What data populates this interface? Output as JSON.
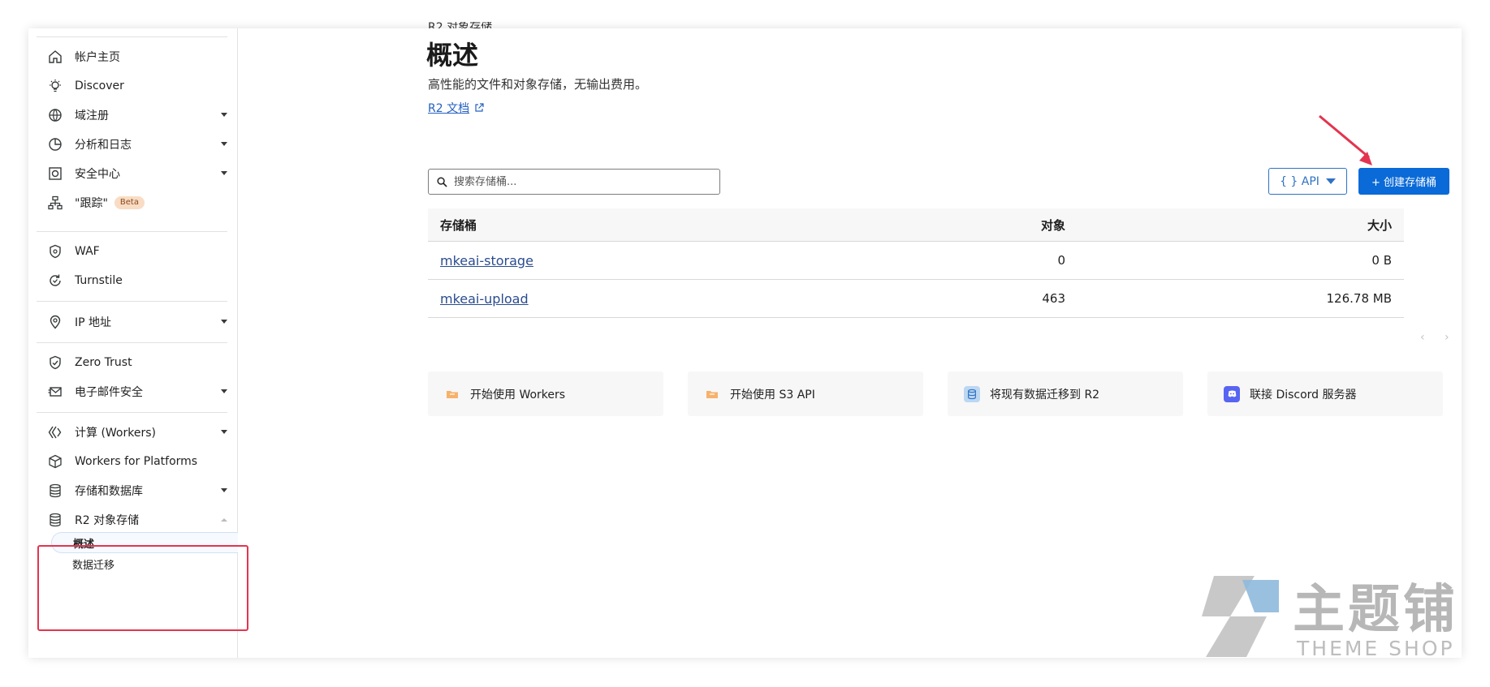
{
  "sidebar": {
    "items": [
      {
        "label": "帐户主页",
        "icon": "home-icon"
      },
      {
        "label": "Discover",
        "icon": "bulb-icon"
      },
      {
        "label": "域注册",
        "icon": "globe-icon"
      },
      {
        "label": "分析和日志",
        "icon": "chart-icon"
      },
      {
        "label": "安全中心",
        "icon": "security-icon"
      },
      {
        "label": "\"跟踪\"",
        "icon": "sitemap-icon",
        "badge": "Beta"
      },
      {
        "label": "WAF",
        "icon": "shield-icon"
      },
      {
        "label": "Turnstile",
        "icon": "turnstile-icon"
      },
      {
        "label": "IP 地址",
        "icon": "location-icon"
      },
      {
        "label": "Zero Trust",
        "icon": "zero-trust-icon"
      },
      {
        "label": "电子邮件安全",
        "icon": "email-icon"
      },
      {
        "label": "计算 (Workers)",
        "icon": "workers-icon"
      },
      {
        "label": "Workers for Platforms",
        "icon": "platforms-icon"
      },
      {
        "label": "存储和数据库",
        "icon": "database-icon"
      },
      {
        "label": "R2 对象存储",
        "icon": "database-icon"
      }
    ],
    "sub_items": [
      {
        "label": "概述",
        "active": true
      },
      {
        "label": "数据迁移",
        "active": false
      }
    ]
  },
  "header": {
    "breadcrumb": "R2 对象存储",
    "title": "概述",
    "subtitle": "高性能的文件和对象存储，无输出费用。",
    "doc_link": "R2 文档"
  },
  "toolbar": {
    "search_placeholder": "搜索存储桶...",
    "api_label": "{ } API",
    "create_label": "+ 创建存储桶"
  },
  "table": {
    "headers": [
      "存储桶",
      "对象",
      "大小"
    ],
    "rows": [
      {
        "name": "mkeai-storage",
        "objects": "0",
        "size": "0 B"
      },
      {
        "name": "mkeai-upload",
        "objects": "463",
        "size": "126.78 MB"
      }
    ],
    "pager_prev": "‹",
    "pager_next": "›"
  },
  "cards": [
    {
      "label": "开始使用 Workers",
      "icon": "folder-icon"
    },
    {
      "label": "开始使用 S3 API",
      "icon": "folder-icon"
    },
    {
      "label": "将现有数据迁移到 R2",
      "icon": "database-icon"
    },
    {
      "label": "联接 Discord 服务器",
      "icon": "discord-icon"
    }
  ],
  "watermark": {
    "title": "主题铺",
    "subtitle": "THEME SHOP"
  },
  "colors": {
    "primary": "#0a6ad7",
    "link": "#2a4c8e",
    "highlight": "#e3344f",
    "arrow": "#e3344f"
  }
}
